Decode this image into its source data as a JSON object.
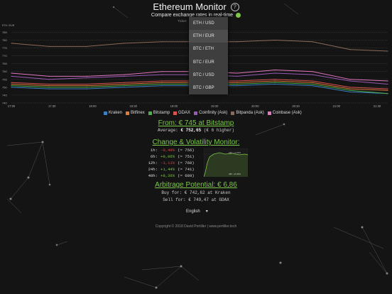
{
  "header": {
    "title": "Ethereum Monitor",
    "subtitle": "Compare exchange rates in real-time",
    "help_icon": "question-circle-icon",
    "live_color": "#7cc64a"
  },
  "ticker": {
    "label": "Ticker:",
    "selected": "ETH / EUR",
    "options": [
      "ETH / USD",
      "ETH / EUR",
      "BTC / ETH",
      "BTC / EUR",
      "BTC / USD",
      "BTC / GBP"
    ]
  },
  "chart_data": {
    "type": "line",
    "ylabel": "ETH / EUR",
    "y_ticks": [
      785,
      780,
      775,
      770,
      765,
      760,
      755,
      750,
      745,
      740
    ],
    "x_ticks": [
      "17:00",
      "17:30",
      "18:00",
      "18:30",
      "19:00",
      "19:30",
      "20:00",
      "20:30",
      "21:00",
      "21:30"
    ],
    "ylim": [
      740,
      787
    ],
    "x": [
      0,
      10,
      20,
      30,
      40,
      50,
      60,
      70,
      80,
      90,
      100
    ],
    "grid": true,
    "legend_position": "bottom",
    "series": [
      {
        "name": "Kraken",
        "color": "#3a7fc4",
        "values": [
          750,
          749,
          749,
          750,
          751,
          751,
          751,
          752,
          751,
          747,
          746
        ]
      },
      {
        "name": "Bitfinex",
        "color": "#e07b39",
        "values": [
          752,
          751,
          751,
          752,
          753,
          753,
          753,
          754,
          753,
          749,
          748
        ]
      },
      {
        "name": "Bitstamp",
        "color": "#4cae4c",
        "values": [
          751,
          750,
          750,
          751,
          752,
          752,
          752,
          753,
          752,
          748,
          746
        ]
      },
      {
        "name": "GDAX",
        "color": "#d9534f",
        "values": [
          753,
          752,
          752,
          753,
          754,
          754,
          754,
          755,
          754,
          750,
          749
        ]
      },
      {
        "name": "Coinfinity (Ask)",
        "color": "#9b59b6",
        "values": [
          757,
          755,
          756,
          757,
          758,
          758,
          757,
          759,
          758,
          754,
          752
        ]
      },
      {
        "name": "Bitpanda (Ask)",
        "color": "#8b6a5a",
        "values": [
          778,
          776,
          776,
          778,
          779,
          779,
          779,
          780,
          779,
          774,
          773
        ]
      },
      {
        "name": "Coinbase (Ask)",
        "color": "#e377c2",
        "values": [
          759,
          757,
          757,
          758,
          760,
          760,
          759,
          761,
          760,
          755,
          754
        ]
      }
    ]
  },
  "best": {
    "title": "From: € 745  at Bitstamp",
    "average_label": "Average:",
    "average_value": "€ 752,65",
    "average_diff": "(€ 6 higher)"
  },
  "volatility": {
    "title": "Change & Volatility Monitor:",
    "rows": [
      {
        "period": "1h:",
        "change": "-0,49%",
        "ref": "(≈ 756)",
        "sign": "neg"
      },
      {
        "period": "6h:",
        "change": "+0,06%",
        "ref": "(≈ 751)",
        "sign": "pos"
      },
      {
        "period": "12h:",
        "change": "-1,11%",
        "ref": "(≈ 760)",
        "sign": "neg"
      },
      {
        "period": "24h:",
        "change": "+1,44%",
        "ref": "(≈ 741)",
        "sign": "pos"
      },
      {
        "period": "48h:",
        "change": "+8,36%",
        "ref": "(≈ 689)",
        "sign": "pos"
      }
    ],
    "mini_labels": {
      "top": "24h: +1,44%",
      "bottom": "48h: +8,36%"
    }
  },
  "arbitrage": {
    "title": "Arbitrage Potential: € 6,86",
    "buy": "Buy for: € 742,62 at Kraken",
    "sell": "Sell for: € 749,47 at GDAX"
  },
  "language": {
    "selected": "English",
    "chevron": "chevron-down-icon"
  },
  "footer": {
    "text": "Copyright © 2018 David Pertiller | www.pertiller.tech"
  }
}
